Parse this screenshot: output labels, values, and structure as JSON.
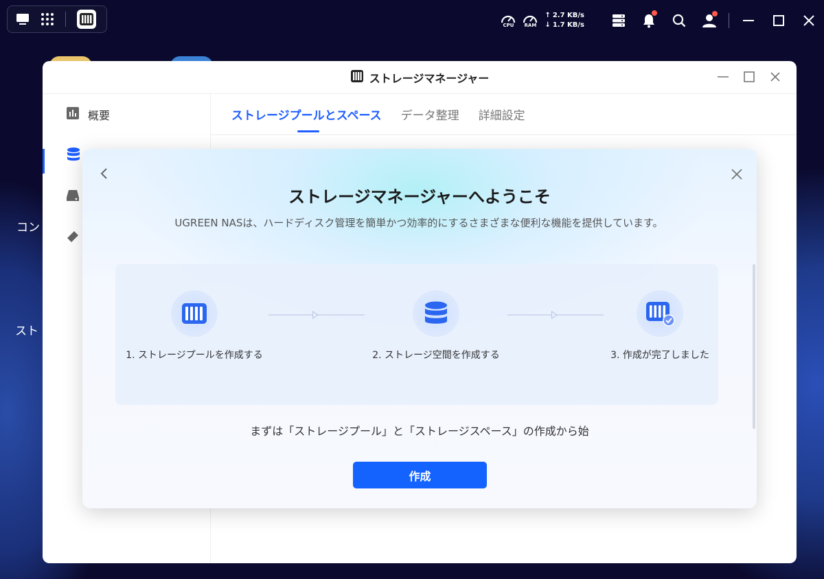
{
  "desktop": {
    "labels": [
      "コン",
      "スト"
    ]
  },
  "tray": {
    "cpu_label": "CPU",
    "ram_label": "RAM",
    "upload": "2.7 KB/s",
    "download": "1.7 KB/s"
  },
  "window": {
    "title": "ストレージマネージャー",
    "sidebar": [
      {
        "label": "概要",
        "icon": "overview-chart-icon"
      },
      {
        "label": "",
        "icon": "database-icon"
      },
      {
        "label": "",
        "icon": "disk-icon"
      },
      {
        "label": "",
        "icon": "eraser-icon"
      }
    ],
    "tabs": [
      "ストレージプールとスペース",
      "データ整理",
      "詳細設定"
    ]
  },
  "modal": {
    "title": "ストレージマネージャーへようこそ",
    "description": "UGREEN NASは、ハードディスク管理を簡単かつ効率的にするさまざまな便利な機能を提供しています。",
    "steps": [
      "1. ストレージプールを作成する",
      "2. ストレージ空間を作成する",
      "3. 作成が完了しました"
    ],
    "note": "まずは「ストレージプール」と「ストレージスペース」の作成から始",
    "create_label": "作成"
  },
  "colors": {
    "accent": "#1e5eff",
    "button": "#1463ff"
  }
}
